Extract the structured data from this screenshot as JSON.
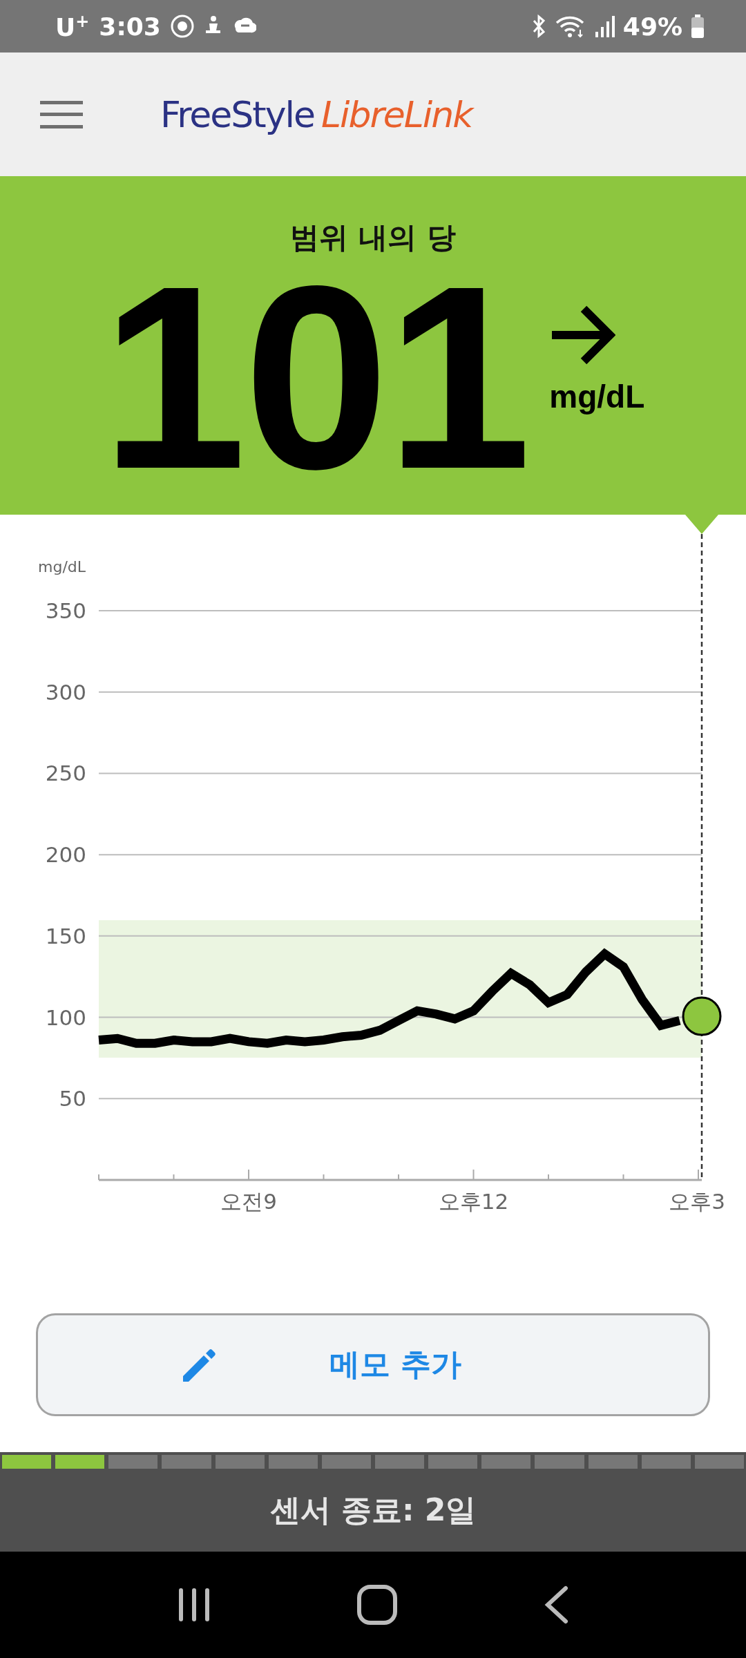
{
  "status_bar": {
    "carrier": "U$^{+}$",
    "time": "3:03",
    "battery": "49%"
  },
  "header": {
    "logo_primary": "FreeStyle",
    "logo_secondary": "LibreLink"
  },
  "reading": {
    "title": "범위 내의 당",
    "value": "101",
    "unit": "mg/dL",
    "arrow": {
      "kind": "steady"
    },
    "in_range": true
  },
  "graph": {
    "unit_label": "mg/dL",
    "chart_data": {
      "type": "line",
      "categories": [
        null,
        null,
        null,
        null,
        null,
        null,
        null,
        null,
        "오전9",
        null,
        null,
        null,
        null,
        null,
        null,
        null,
        null,
        null,
        null,
        null,
        "오후12",
        null,
        null,
        null,
        null,
        null,
        null,
        null,
        null,
        null,
        null,
        null,
        "오후3"
      ],
      "series": [
        {
          "color": "#000000",
          "values": [
            86,
            87,
            84,
            84,
            86,
            85,
            85,
            87,
            85,
            84,
            86,
            85,
            86,
            88,
            89,
            92,
            98,
            104,
            102,
            99,
            104,
            116,
            127,
            120,
            109,
            114,
            128,
            139,
            131,
            111,
            95,
            98,
            null
          ]
        }
      ],
      "ylim": [
        0,
        350
      ],
      "yticks": [
        50,
        100,
        150,
        200,
        250,
        300,
        350
      ],
      "grid": true
    }
  },
  "memo_button": {
    "label": "메모 추가"
  },
  "sensor": {
    "segments": [
      {
        "filled": true
      },
      {
        "filled": true
      },
      {
        "filled": false
      },
      {
        "filled": false
      },
      {
        "filled": false
      },
      {
        "filled": false
      },
      {
        "filled": false
      },
      {
        "filled": false
      },
      {
        "filled": false
      },
      {
        "filled": false
      },
      {
        "filled": false
      },
      {
        "filled": false
      },
      {
        "filled": false
      },
      {
        "filled": false
      }
    ],
    "label": "센서 종료: 2일"
  }
}
